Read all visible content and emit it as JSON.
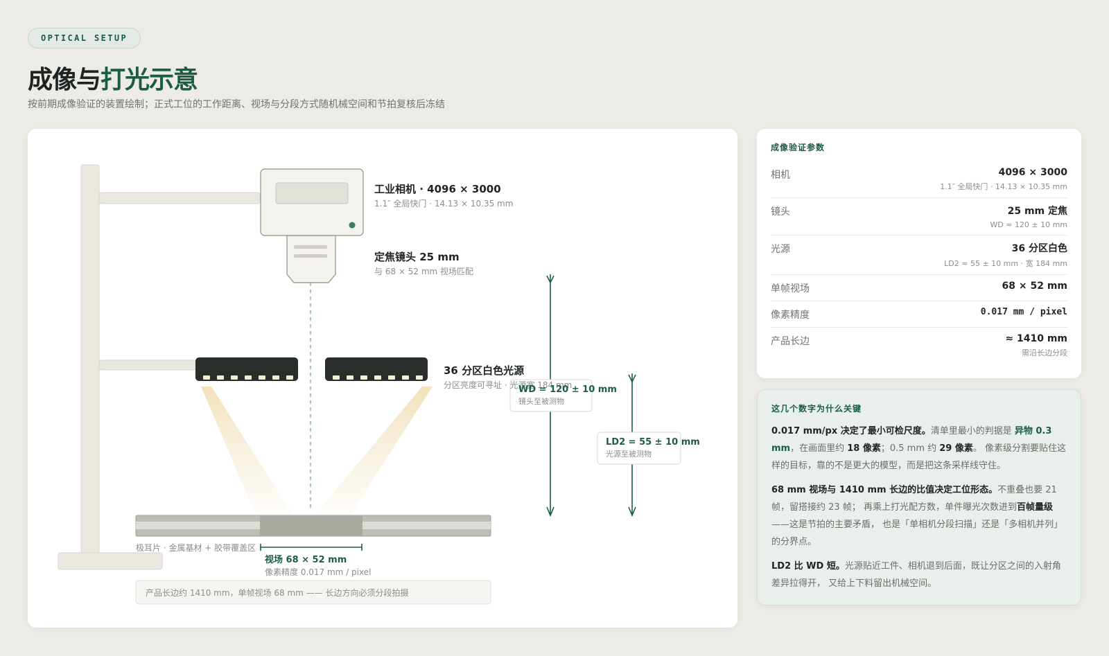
{
  "header": {
    "tag": "OPTICAL SETUP",
    "title_a": "成像与",
    "title_b": "打光示意",
    "subtitle": "按前期成像验证的装置绘制；正式工位的工作距离、视场与分段方式随机械空间和节拍复核后冻结"
  },
  "diagram": {
    "camera_title": "工业相机 · 4096 × 3000",
    "camera_sub": "1.1″ 全局快门 · 14.13 × 10.35 mm",
    "lens_title": "定焦镜头 25 mm",
    "lens_sub": "与 68 × 52 mm 视场匹配",
    "light_title": "36 分区白色光源",
    "light_sub": "分区亮度可寻址 · 光源宽 184 mm",
    "wd_title": "WD = 120 ± 10 mm",
    "wd_sub": "镜头至被测物",
    "ld2_title": "LD2 = 55 ± 10 mm",
    "ld2_sub": "光源至被测物",
    "part_label": "极耳片 · 金属基材 + 胶带覆盖区",
    "fov_title": "视场 68 × 52 mm",
    "fov_sub": "像素精度 0.017 mm / pixel",
    "note": "产品长边约 1410 mm，单帧视场 68 mm —— 长边方向必须分段拍摄"
  },
  "params": {
    "title": "成像验证参数",
    "rows": [
      {
        "label": "相机",
        "main": "4096 × 3000",
        "sub": "1.1″ 全局快门 · 14.13 × 10.35 mm"
      },
      {
        "label": "镜头",
        "main": "25 mm 定焦",
        "sub": "WD ≈ 120 ± 10 mm"
      },
      {
        "label": "光源",
        "main": "36 分区白色",
        "sub": "LD2 ≈ 55 ± 10 mm · 宽 184 mm"
      },
      {
        "label": "单帧视场",
        "main": "68 × 52 mm",
        "sub": ""
      },
      {
        "label": "像素精度",
        "main": "0.017 mm / pixel",
        "sub": ""
      },
      {
        "label": "产品长边",
        "main": "≈ 1410 mm",
        "sub": "需沿长边分段"
      }
    ]
  },
  "why": {
    "title": "这几个数字为什么关键",
    "p1": {
      "b1": "0.017 mm/px 决定了最小可检尺度。",
      "t1": "清单里最小的判据是 ",
      "g1": "异物 0.3 mm",
      "t2": "，在画面里约 ",
      "b2": "18 像素",
      "t3": "；0.5 mm 约 ",
      "b3": "29 像素",
      "t4": "。 像素级分割要贴住这样的目标，靠的不是更大的模型，而是把这条采样线守住。"
    },
    "p2": {
      "b1": "68 mm 视场与 1410 mm 长边的比值决定工位形态。",
      "t1": "不重叠也要 21 帧，留搭接约 23 帧； 再乘上打光配方数，单件曝光次数进到",
      "b2": "百帧量级",
      "t2": "——这是节拍的主要矛盾， 也是「单相机分段扫描」还是「多相机并列」的分界点。"
    },
    "p3": {
      "b1": "LD2 比 WD 短。",
      "t1": "光源贴近工件、相机退到后面，既让分区之间的入射角差异拉得开， 又给上下料留出机械空间。"
    }
  },
  "colors": {
    "accent": "#1d5c44",
    "background": "#ecebe6",
    "light_bar": "#2a2e2b",
    "led": "#f5ecd4"
  }
}
